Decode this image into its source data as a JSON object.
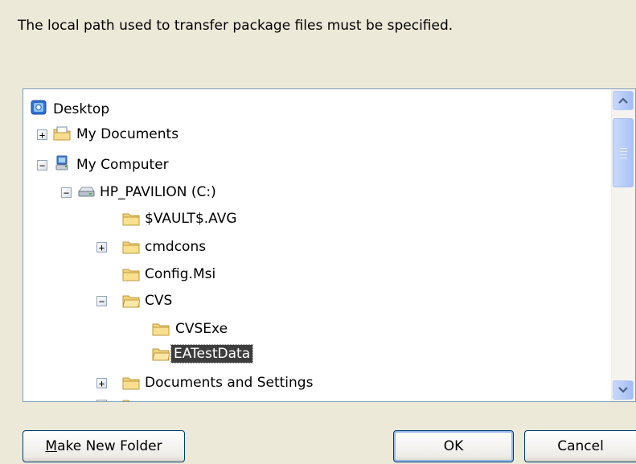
{
  "dialog": {
    "prompt": "The local path used to transfer package files must be specified."
  },
  "tree": {
    "items": [
      {
        "label": "Desktop",
        "icon": "desktop-icon",
        "expander": ""
      },
      {
        "label": "My Documents",
        "icon": "documents-folder-icon",
        "expander": "+"
      },
      {
        "label": "My Computer",
        "icon": "computer-icon",
        "expander": "−"
      },
      {
        "label": "HP_PAVILION (C:)",
        "icon": "drive-icon",
        "expander": "−"
      },
      {
        "label": "$VAULT$.AVG",
        "icon": "folder-icon",
        "expander": ""
      },
      {
        "label": "cmdcons",
        "icon": "folder-icon",
        "expander": "+"
      },
      {
        "label": "Config.Msi",
        "icon": "folder-icon",
        "expander": ""
      },
      {
        "label": "CVS",
        "icon": "folder-open-icon",
        "expander": "−"
      },
      {
        "label": "CVSExe",
        "icon": "folder-icon",
        "expander": ""
      },
      {
        "label": "EATestData",
        "icon": "folder-open-icon",
        "expander": "",
        "selected": true
      },
      {
        "label": "Documents and Settings",
        "icon": "folder-icon",
        "expander": "+"
      }
    ]
  },
  "buttons": {
    "make_new_folder_mnemonic": "M",
    "make_new_folder_rest": "ake New Folder",
    "ok": "OK",
    "cancel": "Cancel"
  },
  "colors": {
    "dialog_bg": "#ECE9D8",
    "selection_bg": "#3D3D3D",
    "tree_border": "#7F9DB9",
    "scroll_accent": "#B2C9F8"
  }
}
